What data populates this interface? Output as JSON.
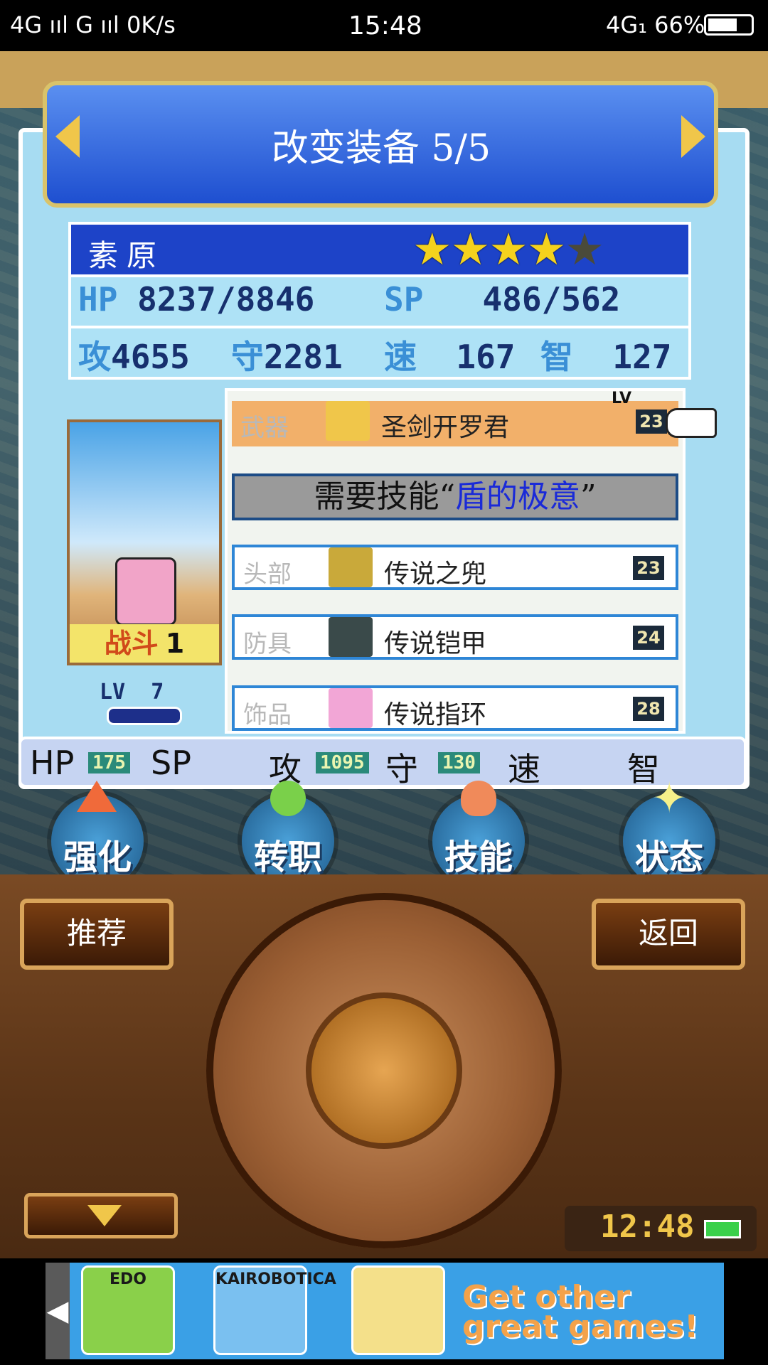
{
  "status_bar": {
    "left_text": "4G ııl G ııl 0K/s",
    "time": "15:48",
    "right_text": "4G₁ 66%"
  },
  "screen": {
    "title": "改变装备 5/5",
    "character": {
      "name": "素原",
      "stars_filled": 4,
      "stars_total": 5,
      "hp_label": "HP",
      "hp_value": "8237/8846",
      "sp_label": "SP",
      "sp_value": "486/562",
      "atk_label": "攻",
      "atk_value": "4655",
      "def_label": "守",
      "def_value": "2281",
      "spd_label": "速",
      "spd_value": "167",
      "int_label": "智",
      "int_value": "127",
      "level_label": "LV",
      "level": "7",
      "job_label": "战斗",
      "job_rank": "1"
    },
    "equipment": {
      "lv_tag": "LV",
      "weapon": {
        "slot": "武器",
        "name": "圣剑开罗君",
        "lv": "23"
      },
      "requirement": {
        "prefix": "需要技能“",
        "skill": "盾的极意",
        "suffix": "”"
      },
      "head": {
        "slot": "头部",
        "name": "传说之兜",
        "lv": "23"
      },
      "armor": {
        "slot": "防具",
        "name": "传说铠甲",
        "lv": "24"
      },
      "accessory": {
        "slot": "饰品",
        "name": "传说指环",
        "lv": "28"
      }
    },
    "bonus_stats": {
      "hp_label": "HP",
      "hp_value": "175",
      "sp_label": "SP",
      "atk_label": "攻",
      "atk_value": "1095",
      "def_label": "守",
      "def_value": "130",
      "spd_label": "速",
      "int_label": "智"
    },
    "menu": [
      {
        "label": "强化"
      },
      {
        "label": "转职"
      },
      {
        "label": "技能"
      },
      {
        "label": "状态"
      }
    ]
  },
  "controller": {
    "recommend_label": "推荐",
    "back_label": "返回",
    "clock": "12:48"
  },
  "ads": {
    "apps": [
      "EDO",
      "KAIROBOTICA",
      ""
    ],
    "more_line1": "Get other",
    "more_line2": "great games!"
  },
  "colors": {
    "title_bar": "#1e4fd0",
    "weapon_highlight": "#f2b06a",
    "skill_text": "#1a2ad8",
    "panel_bg": "#a7dcf2"
  }
}
